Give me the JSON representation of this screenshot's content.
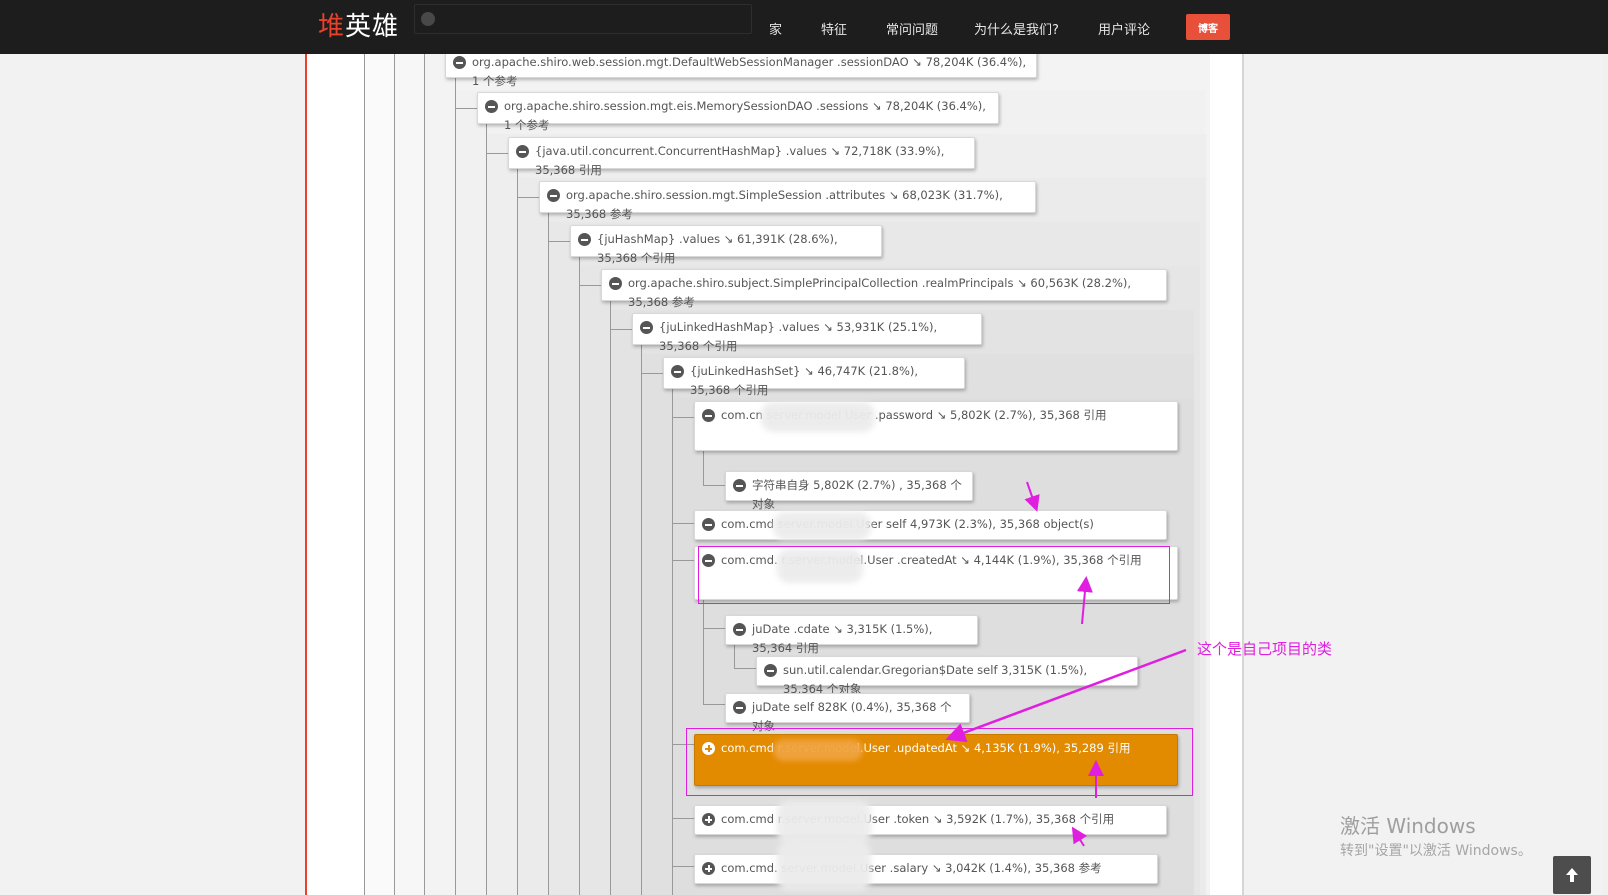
{
  "navbar": {
    "logo_accent": "堆",
    "logo_rest": "英雄",
    "items": [
      "家",
      "特征",
      "常问问题",
      "为什么是我们?",
      "用户评论"
    ],
    "blog_button": "博客"
  },
  "tree": {
    "nodes": [
      {
        "text": "org.apache.shiro.web.session.mgt.DefaultWebSessionManager .sessionDAO ↘ 78,204K (36.4%), 1 个参考",
        "toggle": "minus"
      },
      {
        "text": "org.apache.shiro.session.mgt.eis.MemorySessionDAO .sessions ↘ 78,204K (36.4%), 1 个参考",
        "toggle": "minus"
      },
      {
        "text": "{java.util.concurrent.ConcurrentHashMap} .values ↘ 72,718K (33.9%), 35,368 引用",
        "toggle": "minus"
      },
      {
        "text": "org.apache.shiro.session.mgt.SimpleSession .attributes ↘ 68,023K (31.7%), 35,368 参考",
        "toggle": "minus"
      },
      {
        "text": "{juHashMap} .values ↘ 61,391K (28.6%), 35,368 个引用",
        "toggle": "minus"
      },
      {
        "text": "org.apache.shiro.subject.SimplePrincipalCollection .realmPrincipals ↘ 60,563K (28.2%), 35,368 参考",
        "toggle": "minus"
      },
      {
        "text": "{juLinkedHashMap} .values ↘ 53,931K (25.1%), 35,368 个引用",
        "toggle": "minus"
      },
      {
        "text": "{juLinkedHashSet} ↘ 46,747K (21.8%), 35,368 个引用",
        "toggle": "minus"
      },
      {
        "text": "com.cn                              server.model.User .password ↘ 5,802K (2.7%), 35,368 引用",
        "toggle": "minus"
      },
      {
        "text": "字符串自身 5,802K (2.7%) , 35,368 个对象",
        "toggle": "minus"
      },
      {
        "text": "com.cmd                            server.model.User self 4,973K (2.3%), 35,368 object(s)",
        "toggle": "minus"
      },
      {
        "text": "com.cmd.                           r.server.model.User .createdAt ↘ 4,144K (1.9%), 35,368 个引用",
        "toggle": "minus"
      },
      {
        "text": "juDate .cdate ↘ 3,315K (1.5%), 35,364 引用",
        "toggle": "minus"
      },
      {
        "text": "sun.util.calendar.Gregorian$Date self 3,315K (1.5%), 35,364 个对象",
        "toggle": "minus"
      },
      {
        "text": "juDate self 828K (0.4%), 35,368 个对象",
        "toggle": "minus"
      },
      {
        "text": "com.cmd                            r.server.model.User .updatedAt ↘ 4,135K (1.9%), 35,289 引用",
        "toggle": "plus"
      },
      {
        "text": "com.cmd                            r.server.model.User .token ↘ 3,592K (1.7%), 35,368 个引用",
        "toggle": "plus"
      },
      {
        "text": "com.cmd.                           server.model.User .salary ↘ 3,042K (1.4%), 35,368 参考",
        "toggle": "plus"
      }
    ],
    "selected_color": "#e28a00"
  },
  "annotation": {
    "text": "这个是自己项目的类",
    "color": "#e01ee0"
  },
  "watermark": {
    "title": "激活 Windows",
    "subtitle": "转到\"设置\"以激活 Windows。"
  },
  "icons": {
    "collapse": "minus-circle-icon",
    "expand": "plus-circle-icon",
    "back_to_top": "arrow-up-icon"
  }
}
